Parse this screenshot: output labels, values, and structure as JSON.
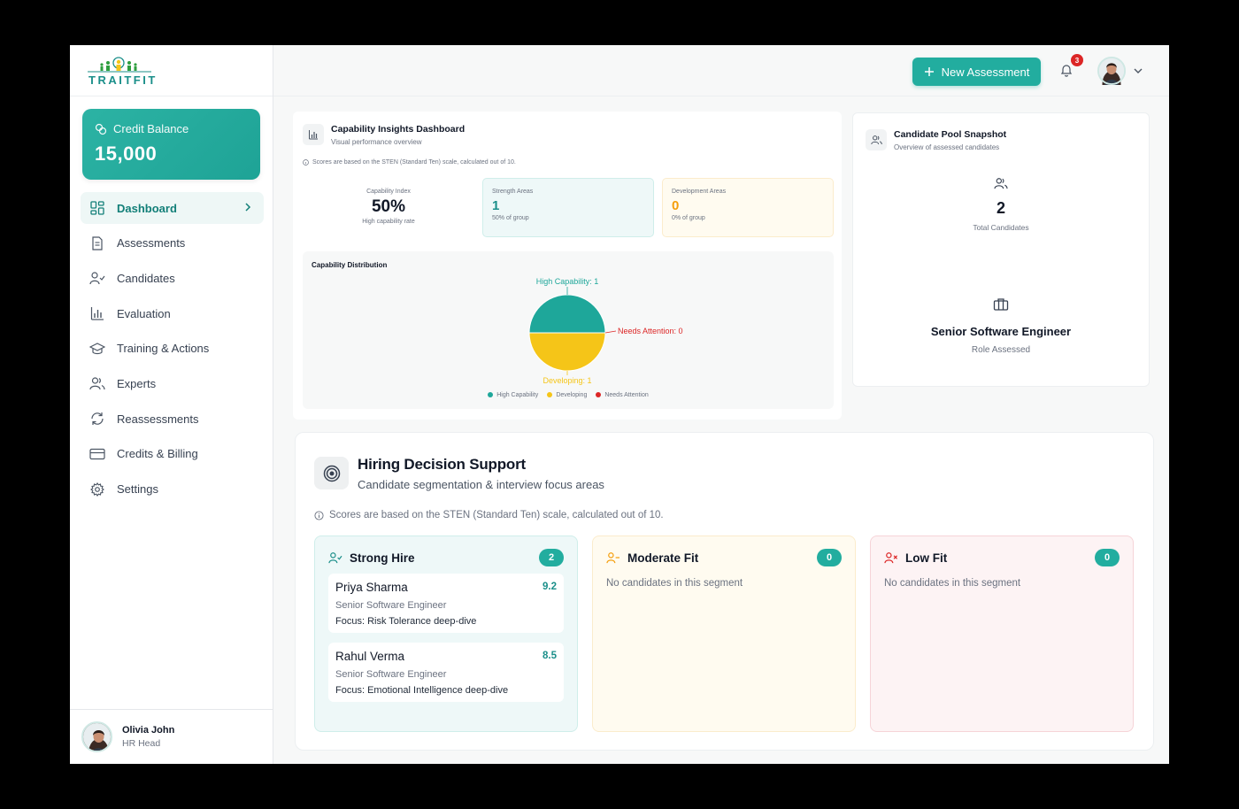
{
  "brand": {
    "logo_text": "TRAITFIT"
  },
  "credit": {
    "label": "Credit Balance",
    "value": "15,000"
  },
  "nav": [
    {
      "label": "Dashboard",
      "icon": "dashboard-icon",
      "active": true
    },
    {
      "label": "Assessments",
      "icon": "document-icon"
    },
    {
      "label": "Candidates",
      "icon": "user-check-icon"
    },
    {
      "label": "Evaluation",
      "icon": "bar-chart-icon"
    },
    {
      "label": "Training & Actions",
      "icon": "graduation-cap-icon"
    },
    {
      "label": "Experts",
      "icon": "users-icon"
    },
    {
      "label": "Reassessments",
      "icon": "refresh-icon"
    },
    {
      "label": "Credits & Billing",
      "icon": "credit-card-icon"
    },
    {
      "label": "Settings",
      "icon": "gear-icon"
    }
  ],
  "user": {
    "name": "Olivia John",
    "role": "HR Head"
  },
  "header": {
    "new_button": "New Assessment",
    "notification_count": "3"
  },
  "capability": {
    "title": "Capability Insights Dashboard",
    "subtitle": "Visual performance overview",
    "note": "Scores are based on the STEN (Standard Ten) scale, calculated out of 10.",
    "index": {
      "label": "Capability Index",
      "value": "50%",
      "sub": "High capability rate"
    },
    "strength": {
      "label": "Strength Areas",
      "value": "1",
      "sub": "50% of group"
    },
    "development": {
      "label": "Development Areas",
      "value": "0",
      "sub": "0% of group"
    },
    "distribution_title": "Capability Distribution"
  },
  "chart_data": {
    "type": "pie",
    "title": "Capability Distribution",
    "categories": [
      "High Capability",
      "Developing",
      "Needs Attention"
    ],
    "values": [
      1,
      1,
      0
    ],
    "colors": [
      "#1ea79a",
      "#f5c518",
      "#dc2626"
    ],
    "slice_labels": [
      "High Capability: 1",
      "Developing: 1",
      "Needs Attention: 0"
    ],
    "legend_position": "bottom"
  },
  "pool": {
    "title": "Candidate Pool Snapshot",
    "subtitle": "Overview of assessed candidates",
    "total_value": "2",
    "total_label": "Total Candidates",
    "role_name": "Senior Software Engineer",
    "role_label": "Role Assessed"
  },
  "hiring": {
    "title": "Hiring Decision Support",
    "subtitle": "Candidate segmentation & interview focus areas",
    "note": "Scores are based on the STEN (Standard Ten) scale, calculated out of 10.",
    "segments": [
      {
        "title": "Strong Hire",
        "count": "2",
        "color": "#1b8f8a",
        "candidates": [
          {
            "name": "Priya Sharma",
            "score": "9.2",
            "role": "Senior Software Engineer",
            "focus": "Focus: Risk Tolerance deep-dive"
          },
          {
            "name": "Rahul Verma",
            "score": "8.5",
            "role": "Senior Software Engineer",
            "focus": "Focus: Emotional Intelligence deep-dive"
          }
        ]
      },
      {
        "title": "Moderate Fit",
        "count": "0",
        "color": "#f59e0b",
        "empty": "No candidates in this segment"
      },
      {
        "title": "Low Fit",
        "count": "0",
        "color": "#dc2626",
        "empty": "No candidates in this segment"
      }
    ]
  }
}
